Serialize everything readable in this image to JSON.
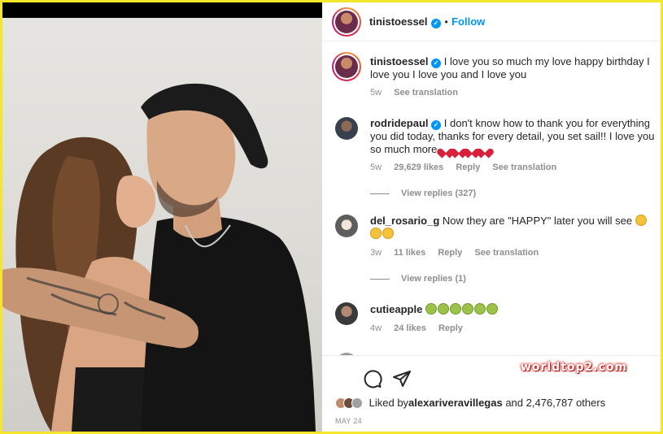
{
  "post_header": {
    "username": "tinistoessel",
    "dot": "•",
    "follow_label": "Follow"
  },
  "caption": {
    "username": "tinistoessel",
    "text": "I love you so much my love happy birthday I love you I love you and I love you",
    "time": "5w",
    "translate": "See translation"
  },
  "comments": [
    {
      "username": "rodridepaul",
      "verified": true,
      "text": "I don't know how to thank you for everything you did today, thanks for every detail, you set sail!! I love you so much more",
      "emoji": [
        "red-heart",
        "red-heart",
        "red-heart",
        "red-heart"
      ],
      "time": "5w",
      "likes": "29,629 likes",
      "reply": "Reply",
      "translate": "See translation",
      "view_replies": "View replies (327)"
    },
    {
      "username": "del_rosario_g",
      "verified": false,
      "text": "Now they are \"HAPPY\" later you will see",
      "emoji": [
        "smirk-face",
        "smirk-face",
        "smirk-face"
      ],
      "time": "3w",
      "likes": "11 likes",
      "reply": "Reply",
      "translate": "See translation",
      "view_replies": "View replies (1)"
    },
    {
      "username": "cutieapple",
      "verified": false,
      "text": "",
      "emoji": [
        "nauseated-face",
        "nauseated-face",
        "nauseated-face",
        "nauseated-face",
        "nauseated-face",
        "nauseated-face"
      ],
      "time": "4w",
      "likes": "24 likes",
      "reply": "Reply"
    }
  ],
  "actions": {
    "icons": [
      "comment-icon",
      "share-icon"
    ],
    "liked_by_prefix": "Liked by",
    "liked_by_user": "alexariveravillegas",
    "liked_by_suffix": "and 2,476,787 others",
    "date": "MAY 24"
  },
  "watermark": "worldtop2.com",
  "colors": {
    "frame": "#f3e62b",
    "link_blue": "#0095f6",
    "muted": "#8e8e8e",
    "text": "#262626"
  }
}
